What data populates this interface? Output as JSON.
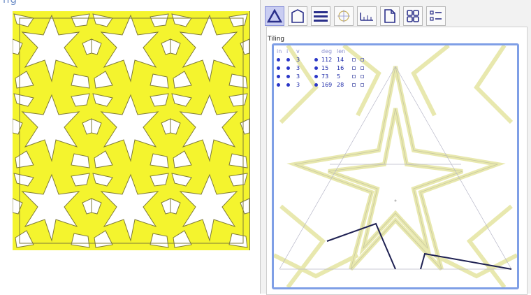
{
  "title_fragment": "ng",
  "colors": {
    "yellow": "#f4f42e",
    "outline": "#7e7a38",
    "accent": "#7f9fe6",
    "toolbar_active": "#c9cdf2",
    "line_dark": "#1e2052"
  },
  "toolbar": {
    "buttons": [
      {
        "icon": "triangle-icon",
        "active": true
      },
      {
        "icon": "shape-outline-icon",
        "active": false
      },
      {
        "icon": "lines-icon",
        "active": false
      },
      {
        "icon": "target-icon",
        "active": false
      },
      {
        "icon": "ruler-icon",
        "active": false
      },
      {
        "icon": "document-icon",
        "active": false
      },
      {
        "icon": "grid-icon",
        "active": false
      },
      {
        "icon": "list-icon",
        "active": false
      }
    ]
  },
  "tiling": {
    "label": "Tiling",
    "table": {
      "headers": [
        "in",
        "i",
        "v",
        "",
        "deg",
        "len",
        "",
        ""
      ],
      "rows": [
        {
          "v": "3",
          "deg": "112",
          "len": "14"
        },
        {
          "v": "3",
          "deg": "15",
          "len": "16"
        },
        {
          "v": "3",
          "deg": "73",
          "len": "5"
        },
        {
          "v": "3",
          "deg": "169",
          "len": "28"
        }
      ]
    }
  }
}
